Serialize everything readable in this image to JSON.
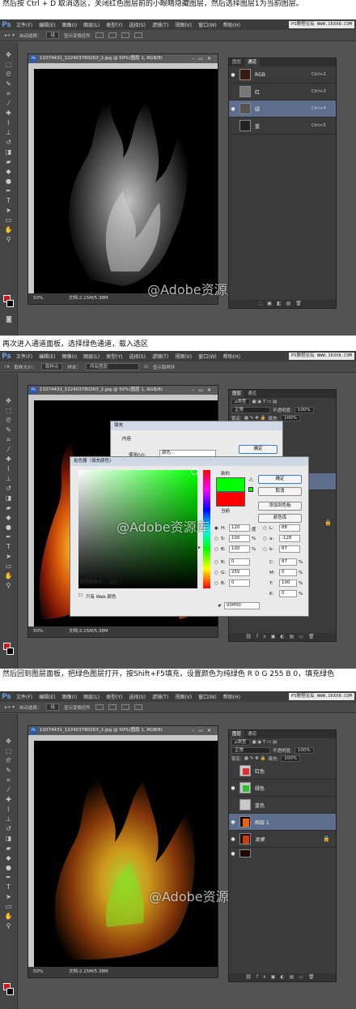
{
  "captions": [
    "然后按 Ctrl + D 取消选区，关闭红色图层前的小眼睛隐藏图层，然后选择图层1为当前图层。",
    "再次进入通道面板，选择绿色通道，载入选区",
    "然后回到图层面板，把绿色图层打开，按Shift+F5填充，设置颜色为纯绿色 R 0 G 255 B 0，填充绿色"
  ],
  "menubar": {
    "logo": "Ps",
    "items": [
      "文件(F)",
      "编辑(E)",
      "图像(I)",
      "图层(L)",
      "类型(Y)",
      "选择(S)",
      "滤镜(T)",
      "视图(V)",
      "窗口(W)",
      "帮助(H)"
    ],
    "site": "PS教程论坛 WWW.16XX8.COM"
  },
  "options": {
    "shot1": [
      "自动选择：",
      "组",
      "显示变换控件"
    ],
    "shot2": [
      "取样大小：",
      "取样点",
      "样本：",
      "所有图层",
      "显示取样环"
    ]
  },
  "document": {
    "title": "11074431_122403780263_2.jpg @ 50%(图层 1, RGB/8)",
    "zoom": "50%",
    "docsize": "文档:2.15M/5.38M"
  },
  "channels": {
    "tabs": [
      "图层",
      "通道"
    ],
    "rows": [
      {
        "name": "RGB",
        "shortcut": "Ctrl+2"
      },
      {
        "name": "红",
        "shortcut": "Ctrl+3"
      },
      {
        "name": "绿",
        "shortcut": "Ctrl+4"
      },
      {
        "name": "蓝",
        "shortcut": "Ctrl+5"
      }
    ]
  },
  "layers": {
    "tabs": [
      "图层",
      "通道"
    ],
    "kind": "ρ类型",
    "blend": "正常",
    "opacity_label": "不透明度:",
    "opacity": "100%",
    "lock_label": "锁定:",
    "fill_label": "填充:",
    "fill": "100%",
    "rows": [
      "红色",
      "绿色",
      "蓝色",
      "图层 1",
      "背景"
    ]
  },
  "fill_dialog": {
    "title": "填充",
    "content_label": "内容",
    "use_label": "使用(U):",
    "use_value": "颜色...",
    "ok": "确定"
  },
  "picker": {
    "title": "拾色器（填充颜色）",
    "ok": "确定",
    "cancel": "取消",
    "add_swatch": "添加到色板",
    "libraries": "颜色库",
    "new_label": "新的",
    "current_label": "当前",
    "only_web": "只有 Web 颜色",
    "hsb": [
      {
        "k": "H:",
        "v": "120",
        "u": "度"
      },
      {
        "k": "S:",
        "v": "100",
        "u": "%"
      },
      {
        "k": "B:",
        "v": "100",
        "u": "%"
      }
    ],
    "rgb": [
      {
        "k": "R:",
        "v": "0"
      },
      {
        "k": "G:",
        "v": "255"
      },
      {
        "k": "B:",
        "v": "0"
      }
    ],
    "lab": [
      {
        "k": "L:",
        "v": "88"
      },
      {
        "k": "a:",
        "v": "-128"
      },
      {
        "k": "b:",
        "v": "87"
      }
    ],
    "cmyk": [
      {
        "k": "C:",
        "v": "87",
        "u": "%"
      },
      {
        "k": "M:",
        "v": "0",
        "u": "%"
      },
      {
        "k": "Y:",
        "v": "100",
        "u": "%"
      },
      {
        "k": "K:",
        "v": "0",
        "u": "%"
      }
    ],
    "hex_label": "#",
    "hex": "00ff00",
    "hidden_text": "颜色取样点 ... 选区"
  },
  "watermark": "@Adobe资源库",
  "colors": {
    "accent": "#5c6e8c",
    "fg": "#e01010",
    "new_color": "#00ff00",
    "current_color": "#ff0000"
  }
}
